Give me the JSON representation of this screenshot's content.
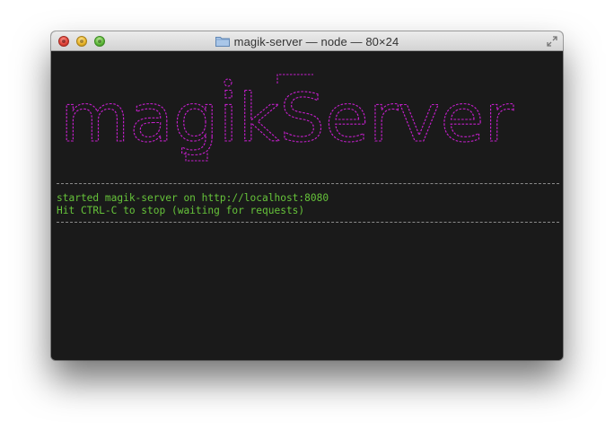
{
  "window": {
    "title": "magik-server — node — 80×24"
  },
  "terminal": {
    "banner_text": "magikServer",
    "banner_color": "#c21fc9",
    "text_color": "#66c33a",
    "lines": [
      "started magik-server on http://localhost:8080",
      "Hit CTRL-C to stop (waiting for requests)"
    ]
  },
  "icons": {
    "folder": "folder-icon",
    "fullscreen": "fullscreen-arrows-icon"
  }
}
